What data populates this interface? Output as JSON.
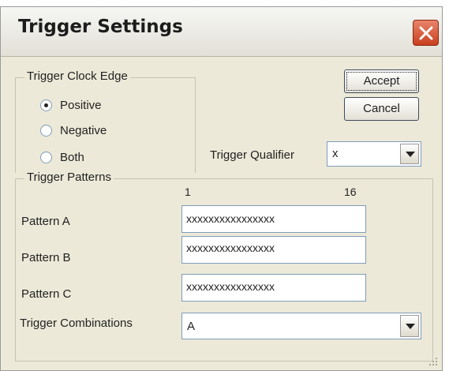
{
  "window": {
    "title": "Trigger Settings"
  },
  "clock_edge": {
    "legend": "Trigger Clock Edge",
    "options": [
      {
        "label": "Positive",
        "checked": true
      },
      {
        "label": "Negative",
        "checked": false
      },
      {
        "label": "Both",
        "checked": false
      }
    ]
  },
  "buttons": {
    "accept": "Accept",
    "cancel": "Cancel"
  },
  "qualifier": {
    "label": "Trigger Qualifier",
    "value": "x"
  },
  "patterns": {
    "legend": "Trigger Patterns",
    "bit_start": "1",
    "bit_end": "16",
    "rows": [
      {
        "label": "Pattern A",
        "value": "xxxxxxxxxxxxxxxx"
      },
      {
        "label": "Pattern B",
        "value": "xxxxxxxxxxxxxxxx"
      },
      {
        "label": "Pattern C",
        "value": "xxxxxxxxxxxxxxxx"
      }
    ],
    "combinations": {
      "label": "Trigger Combinations",
      "value": "A"
    }
  }
}
